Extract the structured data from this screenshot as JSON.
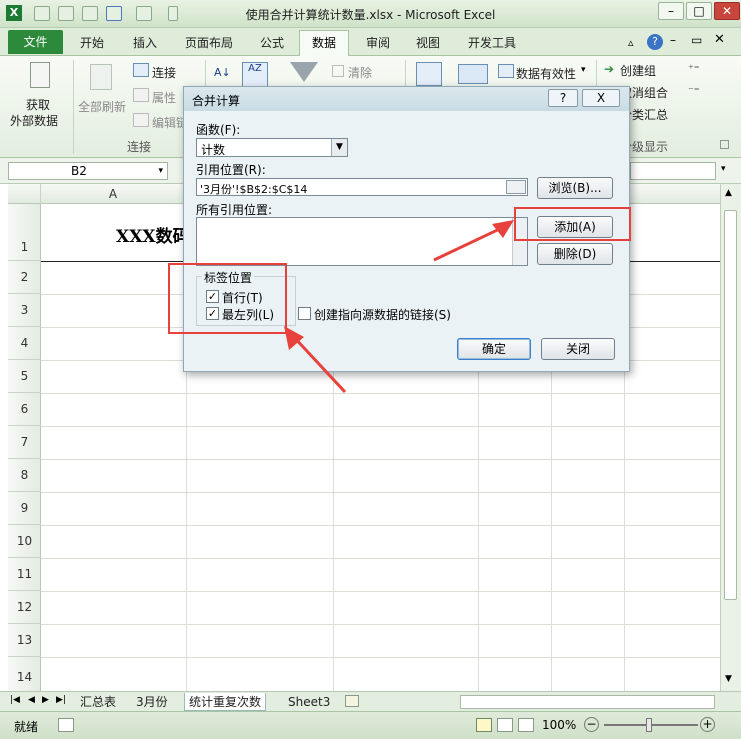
{
  "window": {
    "title": "使用合并计算统计数量.xlsx - Microsoft Excel"
  },
  "tabs": [
    "文件",
    "开始",
    "插入",
    "页面布局",
    "公式",
    "数据",
    "审阅",
    "视图",
    "开发工具"
  ],
  "ribbon": {
    "get_external_1": "获取",
    "get_external_2": "外部数据",
    "refresh_all": "全部刷新",
    "connections": "连接",
    "properties": "属性",
    "edit_links": "编辑链",
    "clear": "清除",
    "data_validation": "数据有效性",
    "create_group": "创建组",
    "ungroup": "取消组合",
    "subtotal": "分类汇总",
    "group_connections": "连接",
    "group_outline": "分级显示"
  },
  "formula_bar": {
    "name_box": "B2"
  },
  "grid": {
    "columns": [
      "A",
      "F"
    ],
    "rows": [
      "1",
      "2",
      "3",
      "4",
      "5",
      "6",
      "7",
      "8",
      "9",
      "10",
      "11",
      "12",
      "13",
      "14"
    ],
    "a1_text": "XXX数码"
  },
  "dialog": {
    "title": "合并计算",
    "function_label": "函数(F):",
    "function_value": "计数",
    "ref_label": "引用位置(R):",
    "ref_value": "'3月份'!$B$2:$C$14",
    "browse": "浏览(B)...",
    "all_refs_label": "所有引用位置:",
    "add": "添加(A)",
    "delete": "删除(D)",
    "label_group": "标签位置",
    "top_row": "首行(T)",
    "left_col": "最左列(L)",
    "create_links": "创建指向源数据的链接(S)",
    "ok": "确定",
    "close": "关闭",
    "help": "?",
    "x": "X",
    "top_row_checked": true,
    "left_col_checked": true,
    "create_links_checked": false
  },
  "sheets": [
    "汇总表",
    "3月份",
    "统计重复次数",
    "Sheet3"
  ],
  "status": {
    "ready": "就绪",
    "zoom": "100%"
  },
  "colors": {
    "accent_red": "#e8413c",
    "file_tab": "#2d8a3b"
  }
}
